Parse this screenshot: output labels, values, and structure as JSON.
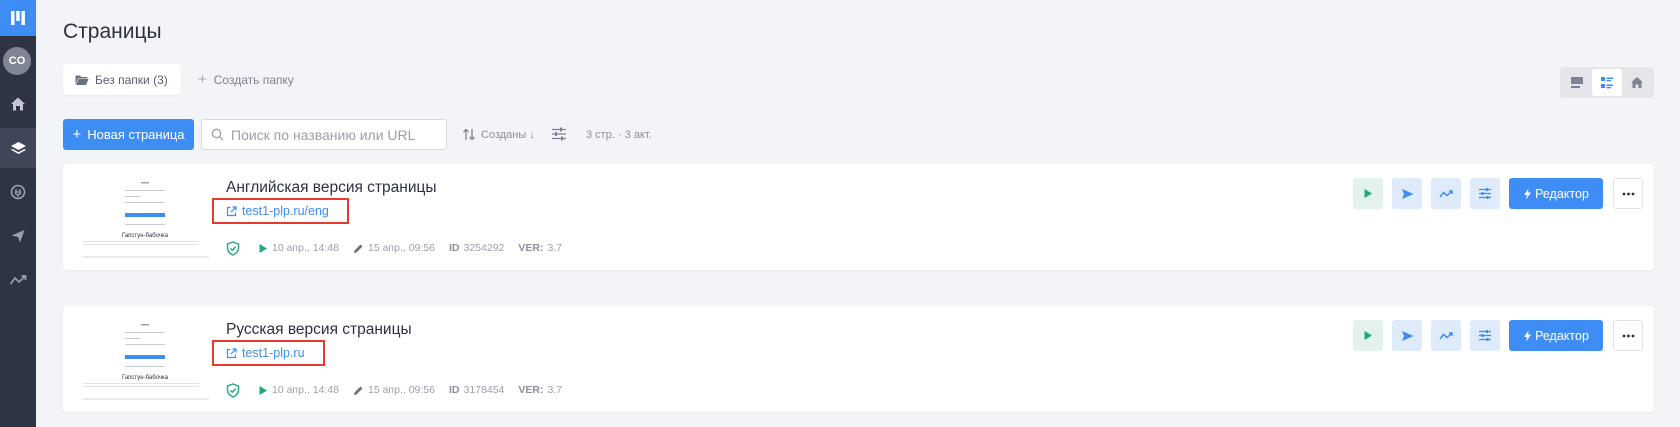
{
  "sidebar": {
    "avatar": "CO",
    "items": [
      {
        "icon": "home-icon"
      },
      {
        "icon": "layers-icon"
      },
      {
        "icon": "plug-icon"
      },
      {
        "icon": "send-icon"
      },
      {
        "icon": "analytics-icon"
      }
    ]
  },
  "page": {
    "title": "Страницы"
  },
  "folders": {
    "current": "Без папки (3)",
    "create": "Создать папку"
  },
  "toolbar": {
    "new_page": "Новая страница",
    "search_placeholder": "Поиск по названию или URL",
    "sort": "Созданы ↓",
    "counts": "3 стр. · 3 акт."
  },
  "pages": [
    {
      "title": "Английская версия страницы",
      "url": "test1-plp.ru/eng",
      "published": "10 апр., 14:48",
      "edited": "15 апр., 09:56",
      "id_label": "ID",
      "id": "3254292",
      "ver_label": "VER:",
      "ver": "3.7",
      "thumb_title": "Гапстун-бабочка"
    },
    {
      "title": "Русская версия страницы",
      "url": "test1-plp.ru",
      "published": "10 апр., 14:48",
      "edited": "15 апр., 09:56",
      "id_label": "ID",
      "id": "3178454",
      "ver_label": "VER:",
      "ver": "3.7",
      "thumb_title": "Гапстун-бабочка"
    }
  ],
  "card_actions": {
    "editor": "Редактор"
  },
  "colors": {
    "accent": "#3d8df5",
    "sidebar": "#2e3444",
    "highlight": "#e53a2d",
    "success": "#1ea97c"
  }
}
